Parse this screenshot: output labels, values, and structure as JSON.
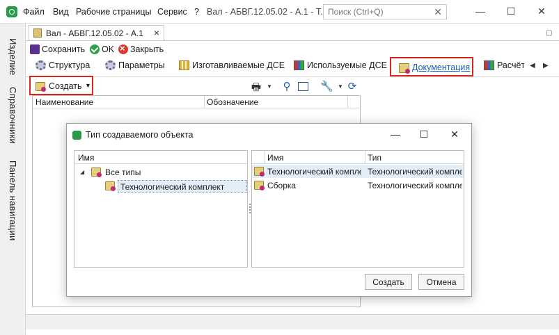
{
  "titlebar": {
    "menu": [
      "Файл",
      "Вид",
      "Рабочие страницы",
      "Сервис",
      "?"
    ],
    "window_title": "Вал - АБВГ.12.05.02 - А.1 - Т...",
    "search_placeholder": "Поиск (Ctrl+Q)",
    "minimize": "—",
    "maximize": "☐",
    "close": "✕"
  },
  "leftnav": [
    "Изделие",
    "Справочники",
    "Панель навигации"
  ],
  "doc": {
    "tab_title": "Вал - АБВГ.12.05.02 - А.1",
    "tab_close": "×",
    "actions": {
      "save": "Сохранить",
      "ok": "OK",
      "close": "Закрыть"
    },
    "ribbon": [
      "Структура",
      "Параметры",
      "Изготавливаемые ДСЕ",
      "Используемые ДСЕ",
      "Документация",
      "Расчёт"
    ],
    "active_ribbon": "Документация",
    "create_label": "Создать",
    "grid_columns": [
      "Наименование",
      "Обозначение"
    ]
  },
  "dialog": {
    "title": "Тип создаваемого объекта",
    "tree_header": "Имя",
    "tree": [
      {
        "label": "Все типы",
        "level": 0,
        "expanded": true
      },
      {
        "label": "Технологический комплект",
        "level": 1,
        "selected": true
      }
    ],
    "list_columns": [
      "Имя",
      "Тип"
    ],
    "list_rows": [
      {
        "name": "Технологический комплект",
        "type": "Технологический комплект"
      },
      {
        "name": "Сборка",
        "type": "Технологический комплект"
      }
    ],
    "buttons": {
      "create": "Создать",
      "cancel": "Отмена"
    }
  },
  "colors": {
    "highlight_border": "#d9261c",
    "link_blue": "#1a5fb4",
    "accent_green": "#2a9a4a"
  }
}
